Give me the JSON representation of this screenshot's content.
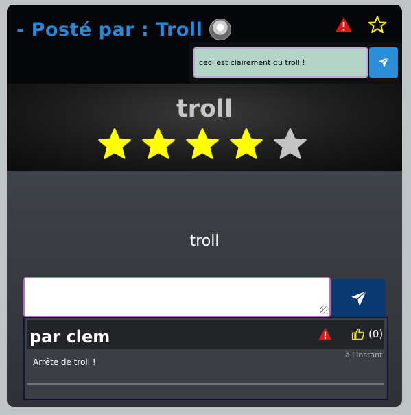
{
  "post": {
    "title": "- Posté par : Troll",
    "avatar_icon": "avatar-icon"
  },
  "header_actions": {
    "report_icon": "warning-icon",
    "favorite_icon": "star-outline-icon",
    "report_color": "#e31616",
    "favorite_color": "#f5e51a"
  },
  "report_popup": {
    "input_value": "ceci est clairement du troll !",
    "send_icon": "paper-plane-icon"
  },
  "rating": {
    "title": "troll",
    "value": 4,
    "max": 5,
    "filled_color": "#ffff00",
    "empty_color": "#c4c4c4"
  },
  "content": {
    "text": "troll"
  },
  "comment_form": {
    "value": "",
    "send_icon": "paper-plane-icon"
  },
  "comments": [
    {
      "author": "par clem",
      "text": "Arrête de troll !",
      "time": "à l'instant",
      "likes": "(0)",
      "like_icon": "thumbs-up-icon",
      "report_icon": "warning-icon"
    }
  ]
}
